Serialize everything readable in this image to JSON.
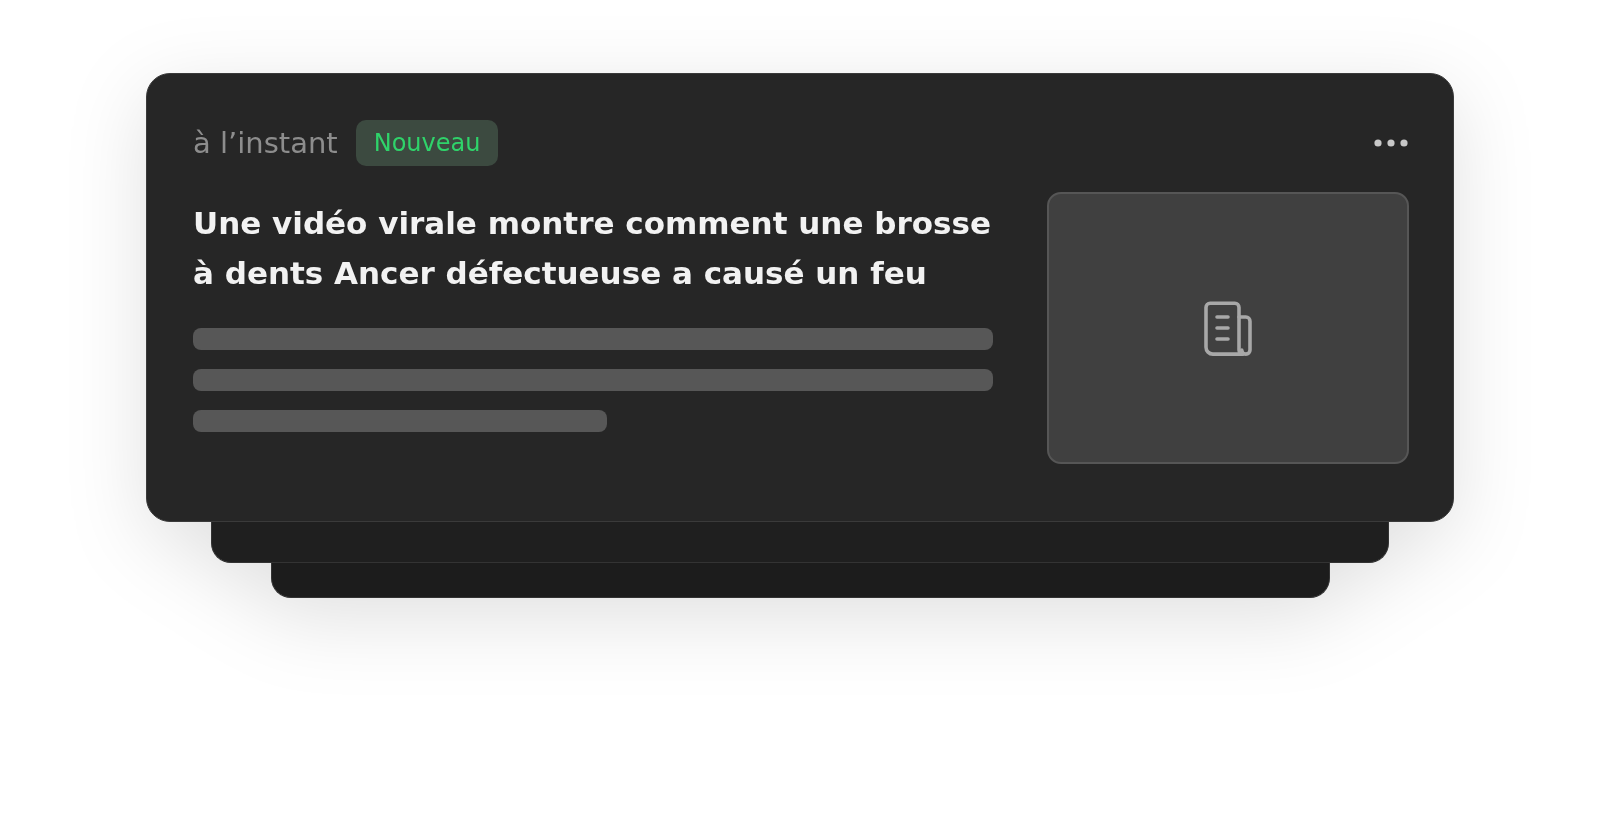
{
  "card": {
    "time": "à l’instant",
    "badge": "Nouveau",
    "title": "Une vidéo virale montre comment une brosse à dents Ancer défectueuse a causé un feu"
  }
}
